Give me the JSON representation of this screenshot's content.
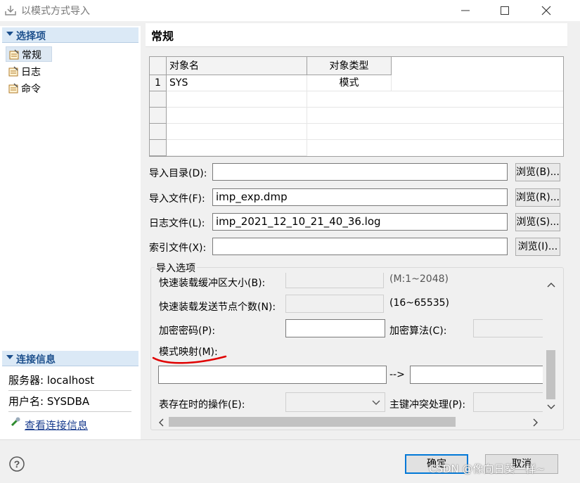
{
  "window": {
    "title": "以模式方式导入"
  },
  "left": {
    "options_section": "选择项",
    "nav": [
      {
        "label": "常规",
        "icon": "options-page-icon"
      },
      {
        "label": "日志",
        "icon": "options-page-icon"
      },
      {
        "label": "命令",
        "icon": "options-page-icon"
      }
    ],
    "connection_section": "连接信息",
    "server": "服务器: localhost",
    "username": "用户名: SYSDBA",
    "view_link": "查看连接信息"
  },
  "main": {
    "header": "常规",
    "table": {
      "columns": [
        "对象名",
        "对象类型"
      ],
      "rows": [
        {
          "num": "1",
          "name": "SYS",
          "type": "模式"
        }
      ]
    },
    "import_dir": {
      "label": "导入目录(D):",
      "value": "",
      "browse": "浏览(B)..."
    },
    "import_file": {
      "label": "导入文件(F):",
      "value": "imp_exp.dmp",
      "browse": "浏览(R)..."
    },
    "log_file": {
      "label": "日志文件(L):",
      "value": "imp_2021_12_10_21_40_36.log",
      "browse": "浏览(S)..."
    },
    "index_file": {
      "label": "索引文件(X):",
      "value": "",
      "browse": "浏览(I)..."
    },
    "options": {
      "title": "导入选项",
      "fast_buffer_label": "快速装载缓冲区大小(B):",
      "fast_buffer_range": "(M:1~2048)",
      "fast_nodes_label": "快速装载发送节点个数(N):",
      "fast_nodes_range": "(16~65535)",
      "password_label": "加密密码(P):",
      "algorithm_label": "加密算法(C):",
      "mapping_label": "模式映射(M):",
      "mapping_arrow": "-->",
      "table_exists_label": "表存在时的操作(E):",
      "pk_conflict_label": "主键冲突处理(P):"
    }
  },
  "footer": {
    "ok": "确定",
    "cancel": "取消",
    "watermark": "CSDN @像向日葵一样~"
  },
  "colors": {
    "accent": "#1c4f8c",
    "annotation": "#e00000"
  }
}
